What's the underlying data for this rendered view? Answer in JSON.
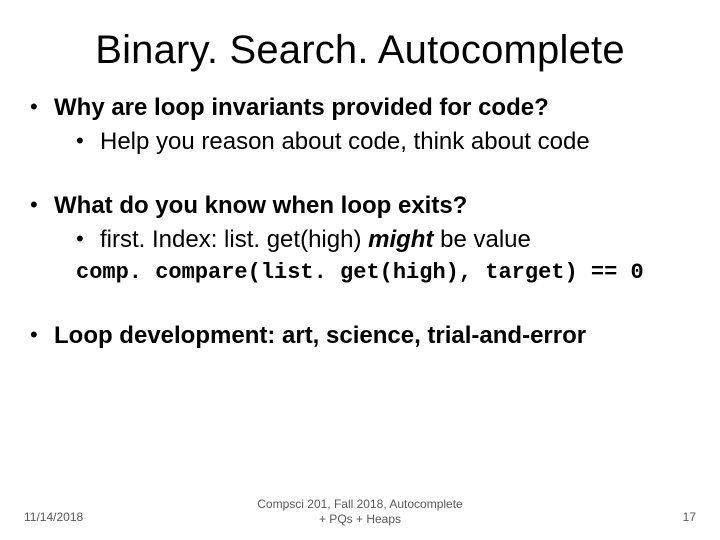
{
  "title": "Binary. Search. Autocomplete",
  "bullets": {
    "b1": {
      "text": "Why are loop invariants provided for code?",
      "sub1": "Help you reason about code, think about code"
    },
    "b2": {
      "text": "What do you know when loop exits?",
      "sub1_pre": "first. Index: list. get(high) ",
      "sub1_em": "might",
      "sub1_post": " be value",
      "code": "comp. compare(list. get(high), target) == 0"
    },
    "b3": {
      "text": "Loop development: art, science, trial-and-error"
    }
  },
  "footer": {
    "date": "11/14/2018",
    "center_l1": "Compsci 201, Fall 2018, Autocomplete",
    "center_l2": "+ PQs + Heaps",
    "page": "17"
  },
  "glyphs": {
    "bullet": "•"
  }
}
